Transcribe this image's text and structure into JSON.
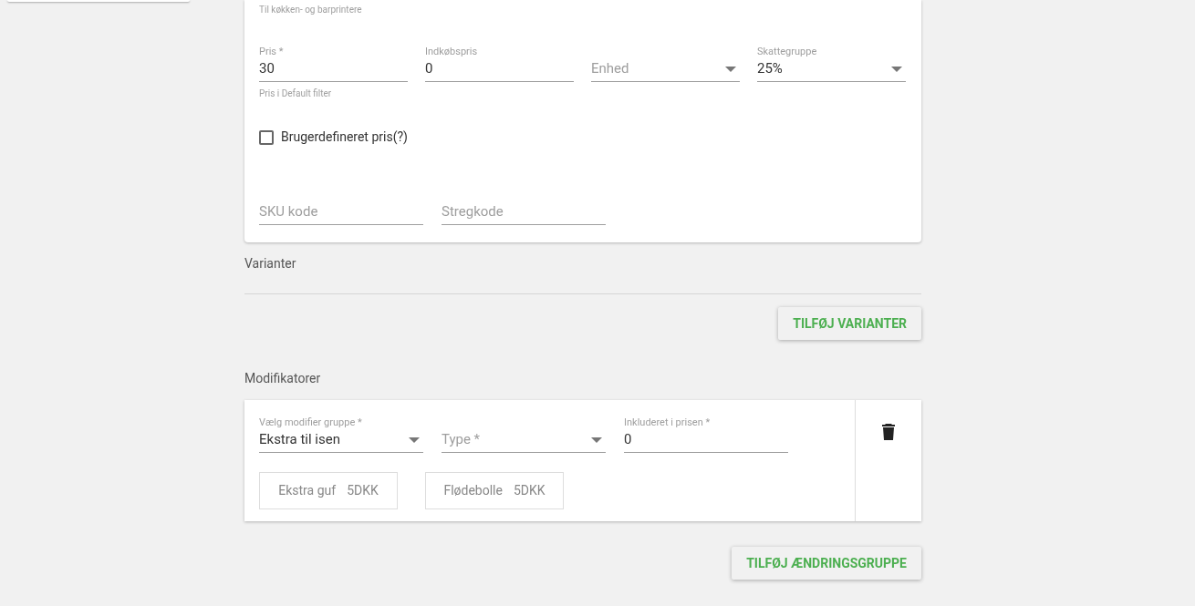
{
  "product_card": {
    "printer_note": "Til køkken- og barprintere",
    "price_fields": [
      {
        "kind": "text",
        "label": "Pris *",
        "value": "30",
        "helper": "Pris i Default filter"
      },
      {
        "kind": "text",
        "label": "Indkøbspris",
        "value": "0"
      },
      {
        "kind": "select",
        "placeholder": "Enhed"
      },
      {
        "kind": "select",
        "label": "Skattegruppe",
        "value": "25%"
      }
    ],
    "custom_price": {
      "label": "Brugerdefineret pris(?)",
      "checked": false
    },
    "code_fields": [
      {
        "placeholder": "SKU kode"
      },
      {
        "placeholder": "Stregkode"
      }
    ]
  },
  "variants": {
    "title": "Varianter",
    "button": "TILFØJ VARIANTER"
  },
  "modifiers": {
    "title": "Modifikatorer",
    "groups": [
      {
        "fields": [
          {
            "kind": "select",
            "label": "Vælg modifier gruppe *",
            "value": "Ekstra til isen"
          },
          {
            "kind": "select",
            "placeholder": "Type *"
          },
          {
            "kind": "text",
            "label": "Inkluderet i prisen *",
            "value": "0"
          }
        ],
        "items": [
          {
            "name": "Ekstra guf",
            "price": "5DKK"
          },
          {
            "name": "Flødebolle",
            "price": "5DKK"
          }
        ]
      }
    ],
    "button": "TILFØJ ÆNDRINGSGRUPPE"
  }
}
